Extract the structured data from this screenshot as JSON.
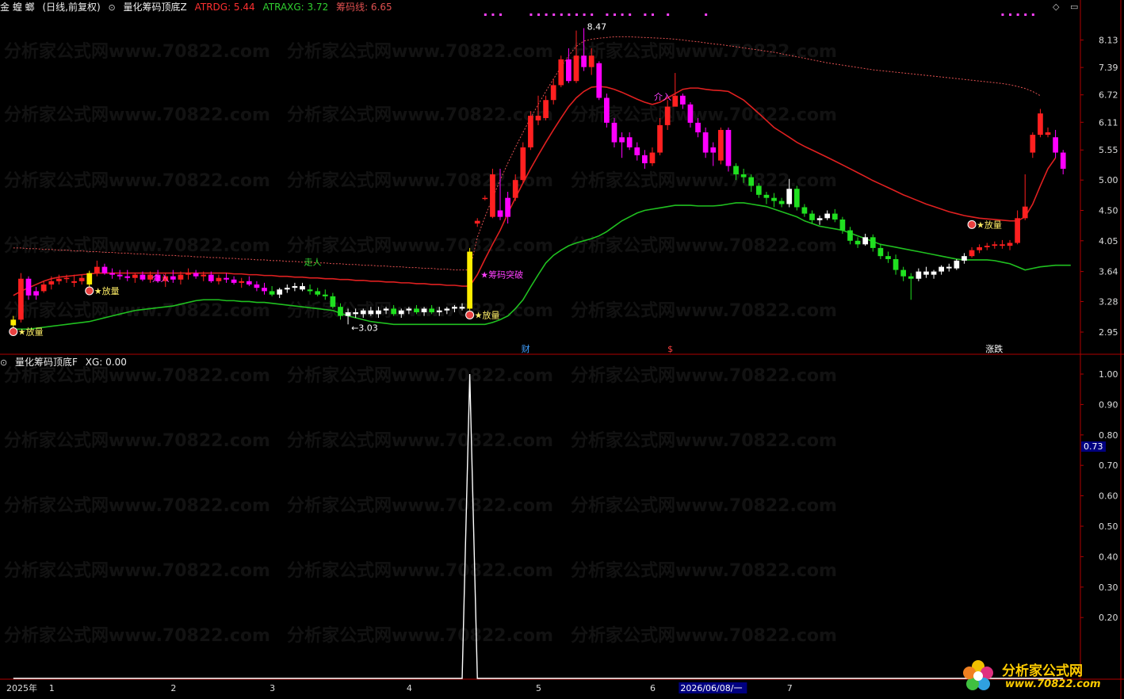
{
  "main_header": {
    "stock_name": "金 蝗 螂",
    "period": "(日线,前复权)",
    "indicator_name": "量化筹码顶底Z",
    "atrdg_label": "ATRDG: 5.44",
    "atraxg_label": "ATRAXG: 3.72",
    "chip_label": "筹码线: 6.65"
  },
  "sub_header": {
    "indicator_name": "量化筹码顶底F",
    "xg_label": "XG: 0.00"
  },
  "colors": {
    "up": "#ff2020",
    "down_pink": "#ff00ff",
    "green": "#20e020",
    "white": "#ffffff",
    "yellow": "#ffee00",
    "axis_red": "#b00000",
    "atrdg": "#e02020",
    "atraxg": "#20c020",
    "chip": "#e05050"
  },
  "annotations": {
    "high_price": "8.47",
    "low_price": "3.03",
    "fangliang": "★放量",
    "chouma_tupo": "筹码突破",
    "zouren": "走人",
    "xieru": "介入",
    "bottom_cai": "财",
    "bottom_s": "$",
    "bottom_zhangdie": "涨跌"
  },
  "price_axis": [
    "8.13",
    "7.39",
    "6.72",
    "6.11",
    "5.55",
    "5.00",
    "4.50",
    "4.05",
    "3.64",
    "3.28",
    "2.95"
  ],
  "sub_axis": [
    "1.00",
    "0.90",
    "0.80",
    "0.70",
    "0.60",
    "0.50",
    "0.40",
    "0.30",
    "0.20"
  ],
  "sub_current": "0.73",
  "date_axis": [
    {
      "label": "2025年",
      "i": 0
    },
    {
      "label": "1",
      "i": 5
    },
    {
      "label": "2",
      "i": 21
    },
    {
      "label": "3",
      "i": 34
    },
    {
      "label": "4",
      "i": 52
    },
    {
      "label": "5",
      "i": 69
    },
    {
      "label": "6",
      "i": 84
    },
    {
      "label": "2026/06/08/一",
      "i": 88
    },
    {
      "label": "7",
      "i": 102
    }
  ],
  "watermark": "分析家公式网www.70822.com",
  "logo": {
    "name": "分析家公式网",
    "url": "www.70822.com"
  },
  "chart_data": {
    "type": "candlestick",
    "title": "量化筹码顶底Z",
    "ylim": [
      2.8,
      8.6
    ],
    "candles": [
      [
        3.02,
        3.12,
        2.98,
        3.08,
        "yellow"
      ],
      [
        3.08,
        3.62,
        3.05,
        3.55,
        "up"
      ],
      [
        3.55,
        3.58,
        3.3,
        3.35,
        "pink"
      ],
      [
        3.35,
        3.45,
        3.3,
        3.4,
        "pink"
      ],
      [
        3.4,
        3.52,
        3.38,
        3.48,
        "up"
      ],
      [
        3.48,
        3.58,
        3.42,
        3.52,
        "up"
      ],
      [
        3.52,
        3.6,
        3.48,
        3.55,
        "up"
      ],
      [
        3.55,
        3.6,
        3.5,
        3.56,
        "up"
      ],
      [
        3.5,
        3.6,
        3.45,
        3.52,
        "up"
      ],
      [
        3.52,
        3.6,
        3.48,
        3.56,
        "up"
      ],
      [
        3.48,
        3.65,
        3.42,
        3.62,
        "yellow"
      ],
      [
        3.62,
        3.78,
        3.58,
        3.7,
        "up"
      ],
      [
        3.7,
        3.74,
        3.6,
        3.62,
        "pink"
      ],
      [
        3.62,
        3.68,
        3.55,
        3.6,
        "pink"
      ],
      [
        3.6,
        3.66,
        3.54,
        3.58,
        "pink"
      ],
      [
        3.58,
        3.66,
        3.52,
        3.56,
        "pink"
      ],
      [
        3.56,
        3.62,
        3.5,
        3.6,
        "up"
      ],
      [
        3.6,
        3.64,
        3.52,
        3.54,
        "pink"
      ],
      [
        3.54,
        3.64,
        3.5,
        3.6,
        "up"
      ],
      [
        3.6,
        3.66,
        3.5,
        3.52,
        "pink"
      ],
      [
        3.52,
        3.62,
        3.45,
        3.58,
        "up"
      ],
      [
        3.58,
        3.66,
        3.5,
        3.54,
        "pink"
      ],
      [
        3.54,
        3.64,
        3.48,
        3.6,
        "up"
      ],
      [
        3.6,
        3.68,
        3.54,
        3.62,
        "up"
      ],
      [
        3.62,
        3.66,
        3.55,
        3.58,
        "pink"
      ],
      [
        3.58,
        3.64,
        3.52,
        3.6,
        "up"
      ],
      [
        3.6,
        3.64,
        3.5,
        3.52,
        "pink"
      ],
      [
        3.52,
        3.6,
        3.48,
        3.56,
        "up"
      ],
      [
        3.56,
        3.62,
        3.5,
        3.54,
        "pink"
      ],
      [
        3.54,
        3.58,
        3.48,
        3.5,
        "pink"
      ],
      [
        3.5,
        3.56,
        3.44,
        3.52,
        "up"
      ],
      [
        3.52,
        3.58,
        3.46,
        3.48,
        "pink"
      ],
      [
        3.48,
        3.52,
        3.4,
        3.44,
        "pink"
      ],
      [
        3.44,
        3.5,
        3.36,
        3.4,
        "pink"
      ],
      [
        3.4,
        3.46,
        3.34,
        3.36,
        "green"
      ],
      [
        3.36,
        3.44,
        3.32,
        3.42,
        "white"
      ],
      [
        3.42,
        3.48,
        3.38,
        3.44,
        "white"
      ],
      [
        3.44,
        3.5,
        3.4,
        3.46,
        "white"
      ],
      [
        3.46,
        3.5,
        3.4,
        3.42,
        "white"
      ],
      [
        3.42,
        3.48,
        3.36,
        3.4,
        "green"
      ],
      [
        3.4,
        3.44,
        3.34,
        3.36,
        "green"
      ],
      [
        3.36,
        3.42,
        3.3,
        3.34,
        "green"
      ],
      [
        3.34,
        3.38,
        3.2,
        3.22,
        "green"
      ],
      [
        3.22,
        3.26,
        3.08,
        3.12,
        "green"
      ],
      [
        3.12,
        3.2,
        3.03,
        3.16,
        "white"
      ],
      [
        3.16,
        3.2,
        3.1,
        3.14,
        "white"
      ],
      [
        3.14,
        3.2,
        3.1,
        3.18,
        "white"
      ],
      [
        3.18,
        3.22,
        3.12,
        3.14,
        "white"
      ],
      [
        3.14,
        3.22,
        3.1,
        3.18,
        "white"
      ],
      [
        3.18,
        3.22,
        3.14,
        3.2,
        "white"
      ],
      [
        3.2,
        3.24,
        3.12,
        3.14,
        "green"
      ],
      [
        3.14,
        3.2,
        3.1,
        3.18,
        "white"
      ],
      [
        3.18,
        3.22,
        3.14,
        3.2,
        "white"
      ],
      [
        3.2,
        3.24,
        3.14,
        3.16,
        "green"
      ],
      [
        3.16,
        3.22,
        3.12,
        3.2,
        "white"
      ],
      [
        3.2,
        3.24,
        3.14,
        3.16,
        "green"
      ],
      [
        3.16,
        3.22,
        3.12,
        3.18,
        "white"
      ],
      [
        3.18,
        3.22,
        3.14,
        3.2,
        "white"
      ],
      [
        3.2,
        3.24,
        3.16,
        3.22,
        "white"
      ],
      [
        3.22,
        3.26,
        3.18,
        3.2,
        "white"
      ],
      [
        3.2,
        3.95,
        3.18,
        3.9,
        "yellow"
      ],
      [
        4.3,
        4.38,
        4.25,
        4.34,
        "up"
      ],
      [
        4.7,
        4.74,
        4.66,
        4.7,
        "up"
      ],
      [
        4.4,
        5.2,
        4.38,
        5.1,
        "up"
      ],
      [
        4.5,
        5.2,
        4.35,
        4.4,
        "pink"
      ],
      [
        4.4,
        4.8,
        4.3,
        4.7,
        "pink"
      ],
      [
        4.7,
        5.1,
        4.65,
        5.0,
        "up"
      ],
      [
        5.0,
        5.7,
        4.95,
        5.6,
        "up"
      ],
      [
        5.6,
        6.35,
        5.55,
        6.25,
        "up"
      ],
      [
        6.25,
        6.7,
        6.05,
        6.15,
        "up"
      ],
      [
        6.2,
        6.7,
        6.15,
        6.6,
        "up"
      ],
      [
        6.6,
        7.1,
        6.5,
        6.95,
        "up"
      ],
      [
        6.95,
        7.7,
        6.9,
        7.6,
        "up"
      ],
      [
        7.6,
        7.9,
        7.0,
        7.05,
        "pink"
      ],
      [
        7.05,
        8.4,
        7.0,
        7.7,
        "up"
      ],
      [
        7.7,
        8.47,
        7.3,
        7.4,
        "pink"
      ],
      [
        7.4,
        7.9,
        7.2,
        7.7,
        "up"
      ],
      [
        7.5,
        7.55,
        6.6,
        6.65,
        "pink"
      ],
      [
        6.65,
        6.75,
        6.0,
        6.1,
        "pink"
      ],
      [
        6.1,
        6.2,
        5.6,
        5.7,
        "pink"
      ],
      [
        5.7,
        5.9,
        5.4,
        5.8,
        "pink"
      ],
      [
        5.8,
        5.9,
        5.55,
        5.6,
        "pink"
      ],
      [
        5.6,
        5.7,
        5.35,
        5.45,
        "pink"
      ],
      [
        5.45,
        5.55,
        5.2,
        5.3,
        "pink"
      ],
      [
        5.3,
        5.6,
        5.25,
        5.5,
        "up"
      ],
      [
        5.5,
        6.2,
        5.45,
        6.05,
        "up"
      ],
      [
        6.05,
        6.6,
        5.95,
        6.45,
        "up"
      ],
      [
        6.45,
        7.25,
        6.55,
        6.7,
        "up"
      ],
      [
        6.7,
        6.75,
        6.4,
        6.5,
        "pink"
      ],
      [
        6.5,
        6.55,
        6.0,
        6.1,
        "pink"
      ],
      [
        6.1,
        6.2,
        5.8,
        5.9,
        "pink"
      ],
      [
        5.9,
        6.0,
        5.4,
        5.5,
        "pink"
      ],
      [
        5.5,
        5.7,
        5.25,
        5.6,
        "pink"
      ],
      [
        5.35,
        6.0,
        5.28,
        5.95,
        "up"
      ],
      [
        5.95,
        6.0,
        5.15,
        5.25,
        "pink"
      ],
      [
        5.25,
        5.3,
        5.0,
        5.1,
        "green"
      ],
      [
        5.1,
        5.2,
        4.95,
        5.05,
        "green"
      ],
      [
        5.05,
        5.1,
        4.8,
        4.9,
        "green"
      ],
      [
        4.9,
        4.95,
        4.7,
        4.75,
        "green"
      ],
      [
        4.75,
        4.8,
        4.6,
        4.7,
        "green"
      ],
      [
        4.7,
        4.78,
        4.55,
        4.65,
        "green"
      ],
      [
        4.65,
        4.7,
        4.55,
        4.6,
        "green"
      ],
      [
        4.6,
        5.02,
        4.55,
        4.85,
        "white"
      ],
      [
        4.85,
        4.9,
        4.5,
        4.55,
        "green"
      ],
      [
        4.55,
        4.6,
        4.4,
        4.45,
        "green"
      ],
      [
        4.45,
        4.5,
        4.3,
        4.35,
        "green"
      ],
      [
        4.35,
        4.42,
        4.28,
        4.38,
        "white"
      ],
      [
        4.38,
        4.5,
        4.35,
        4.45,
        "white"
      ],
      [
        4.45,
        4.52,
        4.32,
        4.36,
        "green"
      ],
      [
        4.36,
        4.4,
        4.15,
        4.2,
        "green"
      ],
      [
        4.2,
        4.25,
        4.0,
        4.05,
        "green"
      ],
      [
        4.05,
        4.1,
        3.95,
        4.0,
        "green"
      ],
      [
        4.0,
        4.15,
        3.98,
        4.1,
        "white"
      ],
      [
        4.1,
        4.14,
        3.9,
        3.95,
        "green"
      ],
      [
        3.95,
        4.0,
        3.8,
        3.84,
        "green"
      ],
      [
        3.84,
        3.9,
        3.75,
        3.8,
        "green"
      ],
      [
        3.8,
        3.86,
        3.6,
        3.66,
        "green"
      ],
      [
        3.66,
        3.7,
        3.52,
        3.58,
        "green"
      ],
      [
        3.58,
        3.62,
        3.3,
        3.55,
        "green"
      ],
      [
        3.55,
        3.68,
        3.52,
        3.64,
        "white"
      ],
      [
        3.64,
        3.7,
        3.56,
        3.6,
        "white"
      ],
      [
        3.6,
        3.66,
        3.55,
        3.64,
        "white"
      ],
      [
        3.64,
        3.72,
        3.6,
        3.7,
        "white"
      ],
      [
        3.7,
        3.74,
        3.64,
        3.68,
        "white"
      ],
      [
        3.68,
        3.8,
        3.66,
        3.78,
        "white"
      ],
      [
        3.78,
        3.88,
        3.74,
        3.84,
        "white"
      ],
      [
        3.84,
        3.96,
        3.82,
        3.92,
        "up"
      ],
      [
        3.92,
        4.0,
        3.88,
        3.96,
        "up"
      ],
      [
        3.96,
        4.02,
        3.92,
        3.98,
        "up"
      ],
      [
        3.98,
        4.04,
        3.94,
        4.0,
        "up"
      ],
      [
        4.0,
        4.06,
        3.94,
        3.98,
        "up"
      ],
      [
        3.98,
        4.06,
        3.92,
        4.02,
        "up"
      ],
      [
        4.02,
        4.5,
        4.0,
        4.38,
        "up"
      ],
      [
        4.38,
        5.1,
        4.35,
        4.56,
        "up"
      ],
      [
        5.5,
        5.9,
        5.4,
        5.85,
        "up"
      ],
      [
        5.85,
        6.4,
        5.8,
        6.3,
        "up"
      ],
      [
        5.9,
        6.0,
        5.8,
        5.85,
        "up"
      ],
      [
        5.8,
        5.95,
        5.4,
        5.5,
        "pink"
      ],
      [
        5.5,
        5.55,
        5.1,
        5.2,
        "pink"
      ]
    ],
    "ref_high_line": [
      3.95,
      3.95,
      3.94,
      3.94,
      3.93,
      3.93,
      3.92,
      3.92,
      3.91,
      3.91,
      3.9,
      3.9,
      3.89,
      3.89,
      3.88,
      3.88,
      3.87,
      3.87,
      3.86,
      3.86,
      3.85,
      3.85,
      3.84,
      3.84,
      3.83,
      3.83,
      3.82,
      3.82,
      3.81,
      3.81,
      3.8,
      3.8,
      3.79,
      3.79,
      3.78,
      3.78,
      3.77,
      3.77,
      3.76,
      3.76,
      3.75,
      3.75,
      3.74,
      3.74,
      3.73,
      3.73,
      3.72,
      3.72,
      3.71,
      3.71,
      3.7,
      3.7,
      3.69,
      3.69,
      3.68,
      3.68,
      3.67,
      3.67,
      3.66,
      3.66,
      3.66,
      4.1,
      4.4,
      4.7,
      5.0,
      5.3,
      5.6,
      5.9,
      6.2,
      6.5,
      6.8,
      7.1,
      7.4,
      7.7,
      7.95,
      8.1,
      8.15,
      8.18,
      8.2,
      8.22,
      8.22,
      8.22,
      8.21,
      8.2,
      8.19,
      8.18,
      8.17,
      8.15,
      8.13,
      8.1,
      8.08,
      8.05,
      8.02,
      8.0,
      7.97,
      7.94,
      7.91,
      7.88,
      7.85,
      7.82,
      7.79,
      7.75,
      7.71,
      7.67,
      7.63,
      7.59,
      7.55,
      7.51,
      7.48,
      7.45,
      7.42,
      7.39,
      7.36,
      7.33,
      7.31,
      7.29,
      7.27,
      7.25,
      7.23,
      7.21,
      7.19,
      7.17,
      7.15,
      7.13,
      7.11,
      7.09,
      7.07,
      7.05,
      7.03,
      7.01,
      6.99,
      6.96,
      6.92,
      6.87,
      6.8,
      6.7
    ],
    "atrdg": [
      3.35,
      3.4,
      3.44,
      3.48,
      3.52,
      3.55,
      3.57,
      3.58,
      3.59,
      3.6,
      3.61,
      3.62,
      3.62,
      3.62,
      3.62,
      3.62,
      3.62,
      3.62,
      3.62,
      3.62,
      3.62,
      3.62,
      3.62,
      3.62,
      3.62,
      3.62,
      3.62,
      3.62,
      3.62,
      3.61,
      3.61,
      3.6,
      3.6,
      3.59,
      3.59,
      3.58,
      3.58,
      3.57,
      3.57,
      3.56,
      3.56,
      3.55,
      3.55,
      3.54,
      3.54,
      3.53,
      3.53,
      3.52,
      3.52,
      3.51,
      3.51,
      3.5,
      3.5,
      3.49,
      3.49,
      3.48,
      3.48,
      3.47,
      3.47,
      3.46,
      3.46,
      3.6,
      3.8,
      4.0,
      4.2,
      4.45,
      4.7,
      4.95,
      5.2,
      5.45,
      5.7,
      5.95,
      6.2,
      6.45,
      6.65,
      6.8,
      6.9,
      6.92,
      6.9,
      6.85,
      6.78,
      6.7,
      6.62,
      6.55,
      6.5,
      6.55,
      6.65,
      6.75,
      6.85,
      6.88,
      6.88,
      6.85,
      6.83,
      6.82,
      6.8,
      6.7,
      6.6,
      6.45,
      6.3,
      6.15,
      6.0,
      5.9,
      5.8,
      5.7,
      5.62,
      5.55,
      5.48,
      5.41,
      5.34,
      5.27,
      5.2,
      5.13,
      5.06,
      4.99,
      4.93,
      4.87,
      4.81,
      4.75,
      4.7,
      4.65,
      4.6,
      4.56,
      4.52,
      4.48,
      4.45,
      4.42,
      4.4,
      4.38,
      4.37,
      4.36,
      4.35,
      4.34,
      4.34,
      4.4,
      4.6,
      4.9,
      5.2,
      5.4
    ],
    "atraxg": [
      2.98,
      2.98,
      2.98,
      2.99,
      3.0,
      3.01,
      3.02,
      3.03,
      3.04,
      3.05,
      3.06,
      3.08,
      3.1,
      3.12,
      3.14,
      3.16,
      3.18,
      3.19,
      3.2,
      3.21,
      3.22,
      3.23,
      3.25,
      3.27,
      3.29,
      3.3,
      3.3,
      3.3,
      3.29,
      3.29,
      3.28,
      3.28,
      3.27,
      3.27,
      3.26,
      3.25,
      3.24,
      3.23,
      3.22,
      3.21,
      3.2,
      3.19,
      3.18,
      3.15,
      3.12,
      3.1,
      3.08,
      3.06,
      3.05,
      3.04,
      3.03,
      3.03,
      3.03,
      3.03,
      3.03,
      3.03,
      3.03,
      3.03,
      3.03,
      3.03,
      3.03,
      3.03,
      3.03,
      3.05,
      3.08,
      3.12,
      3.2,
      3.3,
      3.45,
      3.6,
      3.75,
      3.85,
      3.92,
      3.98,
      4.02,
      4.05,
      4.08,
      4.12,
      4.18,
      4.26,
      4.34,
      4.4,
      4.46,
      4.5,
      4.52,
      4.54,
      4.56,
      4.58,
      4.58,
      4.58,
      4.57,
      4.57,
      4.57,
      4.58,
      4.6,
      4.62,
      4.62,
      4.6,
      4.58,
      4.56,
      4.52,
      4.48,
      4.44,
      4.4,
      4.34,
      4.3,
      4.26,
      4.24,
      4.22,
      4.2,
      4.16,
      4.12,
      4.08,
      4.04,
      4.0,
      3.98,
      3.96,
      3.94,
      3.92,
      3.9,
      3.88,
      3.86,
      3.84,
      3.82,
      3.8,
      3.79,
      3.79,
      3.79,
      3.79,
      3.78,
      3.76,
      3.74,
      3.7,
      3.66,
      3.68,
      3.7,
      3.71,
      3.72,
      3.72,
      3.72
    ],
    "xg": {
      "spike_index": 60,
      "values_max": 1.0
    },
    "xlabel": "",
    "ylabel": ""
  }
}
